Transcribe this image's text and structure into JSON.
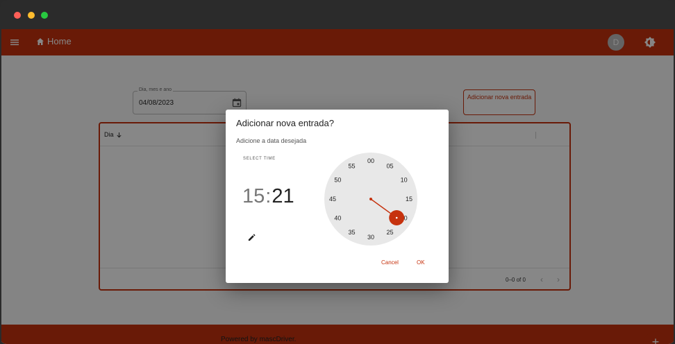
{
  "window": {
    "controls": [
      "close",
      "minimize",
      "maximize"
    ]
  },
  "appbar": {
    "home_label": "Home",
    "avatar_letter": "D",
    "menu_icon": "menu-icon",
    "home_icon": "home-icon",
    "theme_icon": "theme-toggle-icon"
  },
  "form": {
    "date_label": "Dia, mes e ano",
    "date_value": "04/08/2023",
    "add_button_label": "Adicionar nova entrada"
  },
  "grid": {
    "column_dia": "Dia",
    "pagination_text": "0–0 of 0"
  },
  "footer": {
    "text": "Powered by mascDriver."
  },
  "dialog": {
    "title": "Adicionar nova entrada?",
    "subtitle": "Adicione a data desejada",
    "select_time_label": "SELECT TIME",
    "hour": "15",
    "separator": ":",
    "minute": "21",
    "clock_labels": [
      "00",
      "05",
      "10",
      "15",
      "20",
      "25",
      "30",
      "35",
      "40",
      "45",
      "50",
      "55"
    ],
    "selected_minute": 21,
    "cancel_label": "Cancel",
    "ok_label": "OK"
  },
  "colors": {
    "accent": "#c6320e",
    "overlay": "#000000"
  }
}
